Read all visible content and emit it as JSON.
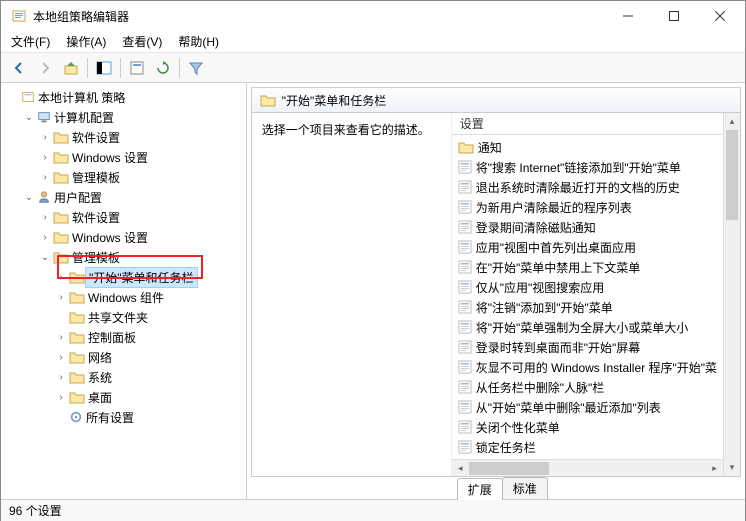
{
  "window": {
    "title": "本地组策略编辑器"
  },
  "menu": {
    "file": "文件(F)",
    "action": "操作(A)",
    "view": "查看(V)",
    "help": "帮助(H)"
  },
  "tree": {
    "root": "本地计算机 策略",
    "computer": "计算机配置",
    "user": "用户配置",
    "software": "软件设置",
    "windows_settings": "Windows 设置",
    "admin_templates": "管理模板",
    "start_taskbar": "\"开始\"菜单和任务栏",
    "windows_components": "Windows 组件",
    "shared_folders": "共享文件夹",
    "control_panel": "控制面板",
    "network": "网络",
    "system": "系统",
    "desktop": "桌面",
    "all_settings": "所有设置"
  },
  "right": {
    "header": "\"开始\"菜单和任务栏",
    "description": "选择一个项目来查看它的描述。",
    "col_header": "设置",
    "items": [
      {
        "type": "folder",
        "label": "通知"
      },
      {
        "type": "setting",
        "label": "将\"搜索 Internet\"链接添加到\"开始\"菜单"
      },
      {
        "type": "setting",
        "label": "退出系统时清除最近打开的文档的历史"
      },
      {
        "type": "setting",
        "label": "为新用户清除最近的程序列表"
      },
      {
        "type": "setting",
        "label": "登录期间清除磁贴通知"
      },
      {
        "type": "setting",
        "label": "应用\"视图中首先列出桌面应用"
      },
      {
        "type": "setting",
        "label": "在\"开始\"菜单中禁用上下文菜单"
      },
      {
        "type": "setting",
        "label": "仅从\"应用\"视图搜索应用"
      },
      {
        "type": "setting",
        "label": "将\"注销\"添加到\"开始\"菜单"
      },
      {
        "type": "setting",
        "label": "将\"开始\"菜单强制为全屏大小或菜单大小"
      },
      {
        "type": "setting",
        "label": "登录时转到桌面而非\"开始\"屏幕"
      },
      {
        "type": "setting",
        "label": "灰显不可用的 Windows Installer 程序\"开始\"菜"
      },
      {
        "type": "setting",
        "label": "从任务栏中删除\"人脉\"栏"
      },
      {
        "type": "setting",
        "label": "从\"开始\"菜单中删除\"最近添加\"列表"
      },
      {
        "type": "setting",
        "label": "关闭个性化菜单"
      },
      {
        "type": "setting",
        "label": "锁定任务栏"
      }
    ]
  },
  "tabs": {
    "extended": "扩展",
    "standard": "标准"
  },
  "status": {
    "text": "96 个设置"
  }
}
